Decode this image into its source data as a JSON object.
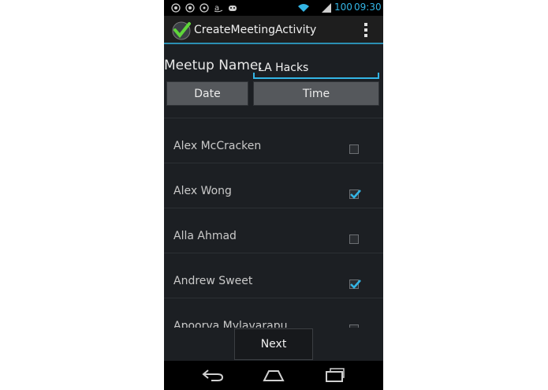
{
  "status_bar": {
    "battery": "100",
    "time": "09:30",
    "icons": [
      "eye-icon",
      "eye-icon",
      "target-icon",
      "amazon-icon",
      "game-controller-icon",
      "wifi-icon",
      "signal-icon"
    ]
  },
  "action_bar": {
    "title": "CreateMeetingActivity",
    "logo": "calendar-check-icon",
    "overflow_icon": "overflow-menu-icon"
  },
  "form": {
    "name_label": "Meetup Name:",
    "name_value": "LA Hacks",
    "date_label": "Date",
    "time_label": "Time"
  },
  "contacts": [
    {
      "name": "Alex McCracken",
      "checked": false
    },
    {
      "name": "Alex Wong",
      "checked": true
    },
    {
      "name": "Alla Ahmad",
      "checked": false
    },
    {
      "name": "Andrew Sweet",
      "checked": true
    },
    {
      "name": "Apoorva Mylavarapu",
      "checked": false
    }
  ],
  "next_label": "Next",
  "nav_bar": {
    "icons": [
      "back-icon",
      "home-icon",
      "recent-apps-icon"
    ]
  },
  "colors": {
    "accent": "#33b5e5",
    "background": "#1c1f23"
  }
}
